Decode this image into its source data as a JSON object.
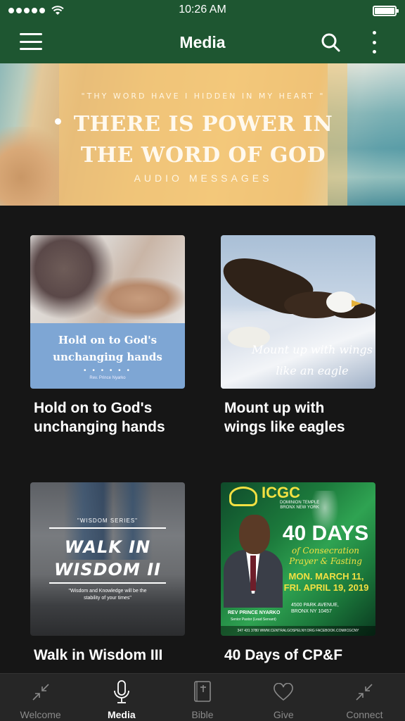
{
  "status_bar": {
    "time": "10:26 AM"
  },
  "nav": {
    "title": "Media"
  },
  "banner": {
    "verse": "\"THY WORD HAVE I HIDDEN IN MY HEART \"",
    "title_line1": "THERE IS POWER IN",
    "title_line2": "THE WORD OF GOD",
    "subtitle": "AUDIO MESSAGES"
  },
  "cards": [
    {
      "title_line1": "Hold on to God's",
      "title_line2": "unchanging hands",
      "art": {
        "line1": "Hold on to God's",
        "line2": "unchanging hands",
        "dots": "• • • • • •",
        "author": "Rev. Prince Nyarko"
      }
    },
    {
      "title_line1": "Mount up with",
      "title_line2": "wings like eagles",
      "art": {
        "line1": "Mount up with wings",
        "line2": "like an eagle"
      }
    },
    {
      "title_line1": "Walk in Wisdom III",
      "art": {
        "series": "\"WISDOM SERIES\"",
        "line1": "WALK IN",
        "line2": "WISDOM II",
        "quote_line1": "\"Wisdom and Knowledge will be the",
        "quote_line2": "stability of your times\""
      }
    },
    {
      "title_line1": "40 Days of CP&F",
      "art": {
        "org": "ICGC",
        "temple_line1": "DOMINION TEMPLE",
        "temple_line2": "BRONX NEW YORK",
        "days": "40 DAYS",
        "cons_line1": "of Consecration",
        "cons_line2": "Prayer & Fasting",
        "date_line1": "MON. MARCH 11,",
        "date_line2": "FRI. APRIL 19, 2019",
        "addr_line1": "4500 PARK AVENUE,",
        "addr_line2": "BRONX NY 10457",
        "speaker": "REV PRINCE NYARKO",
        "role": "Senior Pastor (Lead Servant)",
        "footer": "347 431 3780  WWW.CENTRALGOSPELNY.ORG  FACEBOOK.COM/ICGCNY"
      }
    }
  ],
  "tabs": [
    {
      "label": "Welcome",
      "icon": "collapse-arrows-icon"
    },
    {
      "label": "Media",
      "icon": "microphone-icon"
    },
    {
      "label": "Bible",
      "icon": "bible-icon"
    },
    {
      "label": "Give",
      "icon": "heart-icon"
    },
    {
      "label": "Connect",
      "icon": "collapse-arrows-icon"
    }
  ],
  "colors": {
    "header_green": "#1e5631",
    "background": "#161616",
    "tab_bar": "#262626",
    "tab_active": "#ffffff",
    "tab_inactive": "#8a8a8a"
  }
}
